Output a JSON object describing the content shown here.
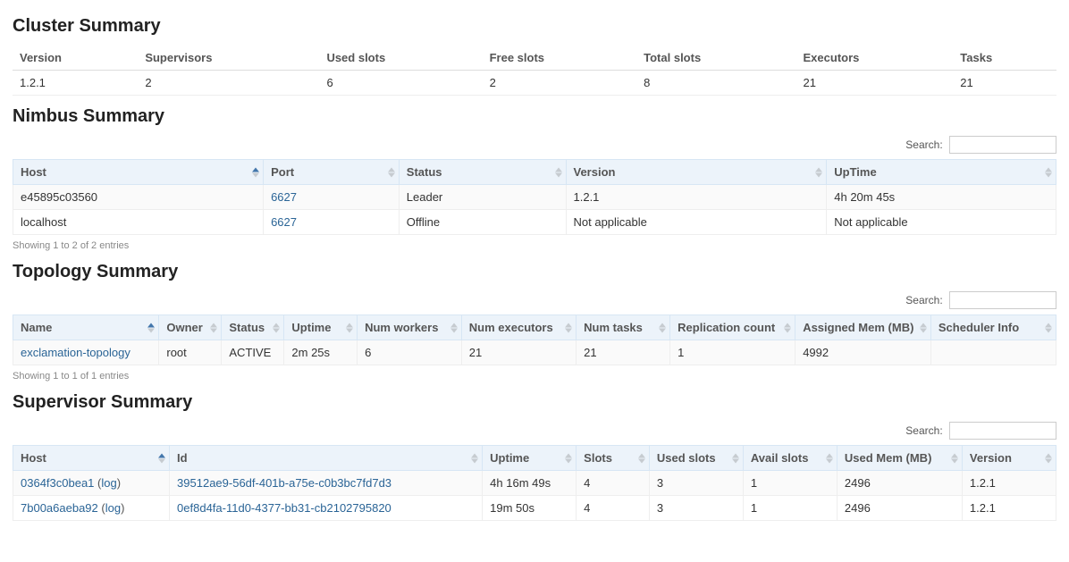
{
  "cluster": {
    "title": "Cluster Summary",
    "headers": [
      "Version",
      "Supervisors",
      "Used slots",
      "Free slots",
      "Total slots",
      "Executors",
      "Tasks"
    ],
    "row": [
      "1.2.1",
      "2",
      "6",
      "2",
      "8",
      "21",
      "21"
    ]
  },
  "nimbus": {
    "title": "Nimbus Summary",
    "search_label": "Search:",
    "headers": [
      "Host",
      "Port",
      "Status",
      "Version",
      "UpTime"
    ],
    "rows": [
      {
        "host": "e45895c03560",
        "port": "6627",
        "status": "Leader",
        "version": "1.2.1",
        "uptime": "4h 20m 45s"
      },
      {
        "host": "localhost",
        "port": "6627",
        "status": "Offline",
        "version": "Not applicable",
        "uptime": "Not applicable"
      }
    ],
    "entries": "Showing 1 to 2 of 2 entries"
  },
  "topology": {
    "title": "Topology Summary",
    "search_label": "Search:",
    "headers": [
      "Name",
      "Owner",
      "Status",
      "Uptime",
      "Num workers",
      "Num executors",
      "Num tasks",
      "Replication count",
      "Assigned Mem (MB)",
      "Scheduler Info"
    ],
    "rows": [
      {
        "name": "exclamation-topology",
        "owner": "root",
        "status": "ACTIVE",
        "uptime": "2m 25s",
        "workers": "6",
        "executors": "21",
        "tasks": "21",
        "replication": "1",
        "mem": "4992",
        "scheduler": ""
      }
    ],
    "entries": "Showing 1 to 1 of 1 entries"
  },
  "supervisor": {
    "title": "Supervisor Summary",
    "search_label": "Search:",
    "headers": [
      "Host",
      "Id",
      "Uptime",
      "Slots",
      "Used slots",
      "Avail slots",
      "Used Mem (MB)",
      "Version"
    ],
    "log_label": "log",
    "rows": [
      {
        "host": "0364f3c0bea1",
        "id": "39512ae9-56df-401b-a75e-c0b3bc7fd7d3",
        "uptime": "4h 16m 49s",
        "slots": "4",
        "used": "3",
        "avail": "1",
        "mem": "2496",
        "version": "1.2.1"
      },
      {
        "host": "7b00a6aeba92",
        "id": "0ef8d4fa-11d0-4377-bb31-cb2102795820",
        "uptime": "19m 50s",
        "slots": "4",
        "used": "3",
        "avail": "1",
        "mem": "2496",
        "version": "1.2.1"
      }
    ]
  }
}
